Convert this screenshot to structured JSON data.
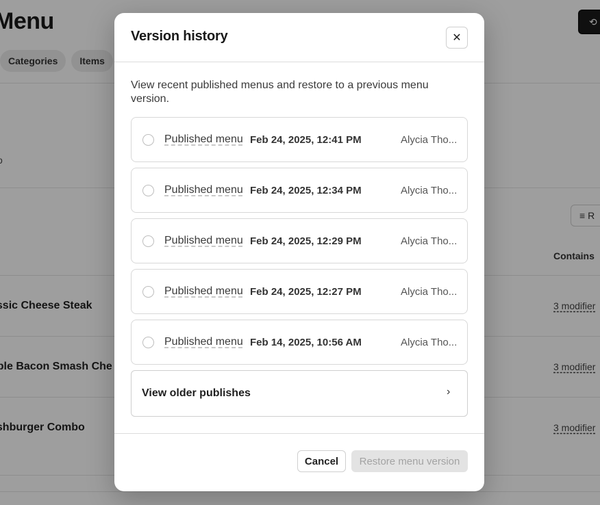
{
  "background": {
    "page_title": "Menu",
    "tabs": [
      {
        "label": "Categories"
      },
      {
        "label": "Items"
      }
    ],
    "history_icon": "history-icon",
    "filter_button_label": "R",
    "contains_header": "Contains",
    "rows": [
      {
        "name": "assic Cheese Steak",
        "modifiers": "3 modifier"
      },
      {
        "name": "uble Bacon Smash Che",
        "modifiers": "3 modifier"
      },
      {
        "name": "ashburger Combo",
        "modifiers": "3 modifier"
      }
    ],
    "stub_text": "o"
  },
  "modal": {
    "title": "Version history",
    "close_icon": "close-icon",
    "description": "View recent published menus and restore to a previous menu version.",
    "versions": [
      {
        "label": "Published menu",
        "date": "Feb 24, 2025, 12:41 PM",
        "author": "Alycia Tho..."
      },
      {
        "label": "Published menu",
        "date": "Feb 24, 2025, 12:34 PM",
        "author": "Alycia Tho..."
      },
      {
        "label": "Published menu",
        "date": "Feb 24, 2025, 12:29 PM",
        "author": "Alycia Tho..."
      },
      {
        "label": "Published menu",
        "date": "Feb 24, 2025, 12:27 PM",
        "author": "Alycia Tho..."
      },
      {
        "label": "Published menu",
        "date": "Feb 14, 2025, 10:56 AM",
        "author": "Alycia Tho..."
      }
    ],
    "older_label": "View older publishes",
    "older_icon": "chevron-right-icon",
    "cancel_label": "Cancel",
    "restore_label": "Restore menu version"
  }
}
